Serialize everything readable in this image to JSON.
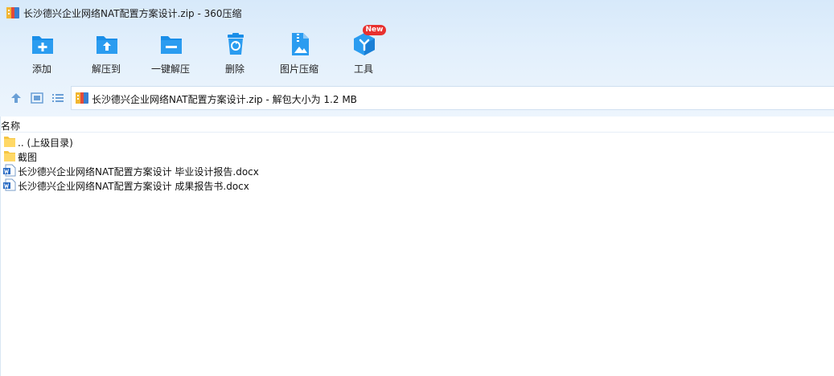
{
  "window": {
    "title": "长沙德兴企业网络NAT配置方案设计.zip - 360压缩"
  },
  "toolbar": {
    "buttons": [
      {
        "label": "添加",
        "icon": "add-folder-icon"
      },
      {
        "label": "解压到",
        "icon": "extract-to-folder-icon"
      },
      {
        "label": "一键解压",
        "icon": "one-click-extract-icon"
      },
      {
        "label": "删除",
        "icon": "recycle-bin-icon"
      },
      {
        "label": "图片压缩",
        "icon": "image-compress-icon"
      },
      {
        "label": "工具",
        "icon": "tools-cube-icon"
      }
    ],
    "new_badge": "New"
  },
  "navbar": {
    "address": "长沙德兴企业网络NAT配置方案设计.zip - 解包大小为 1.2 MB"
  },
  "file_list": {
    "column_name": "名称",
    "items": [
      {
        "name": ".. (上级目录)",
        "type": "folder"
      },
      {
        "name": "截图",
        "type": "folder"
      },
      {
        "name": "长沙德兴企业网络NAT配置方案设计 毕业设计报告.docx",
        "type": "docx"
      },
      {
        "name": "长沙德兴企业网络NAT配置方案设计 成果报告书.docx",
        "type": "docx"
      }
    ]
  },
  "colors": {
    "accent": "#1a8ee8",
    "header_bg": "#dcebfa",
    "badge": "#e8312f",
    "folder": "#f5c542"
  }
}
